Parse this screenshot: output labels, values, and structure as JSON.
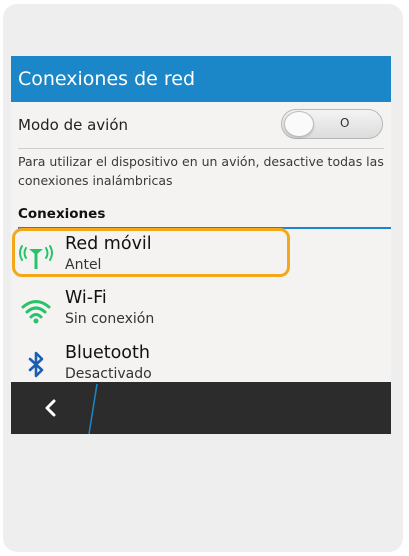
{
  "header": {
    "title": "Conexiones de red"
  },
  "airplane": {
    "label": "Modo de avión",
    "toggle_state": "O",
    "description": "Para utilizar el dispositivo en un avión, desactive todas las conexiones inalámbricas"
  },
  "connections": {
    "header": "Conexiones",
    "items": [
      {
        "name": "Red móvil",
        "status": "Antel",
        "icon": "cellular-antenna-icon"
      },
      {
        "name": "Wi-Fi",
        "status": "Sin conexión",
        "icon": "wifi-icon"
      },
      {
        "name": "Bluetooth",
        "status": "Desactivado",
        "icon": "bluetooth-icon"
      }
    ]
  },
  "colors": {
    "accent": "#1b87c8",
    "highlight": "#f3a81a",
    "icon_green": "#27c36a",
    "icon_blue": "#1b5fb3",
    "bottombar": "#2c2c2c"
  }
}
